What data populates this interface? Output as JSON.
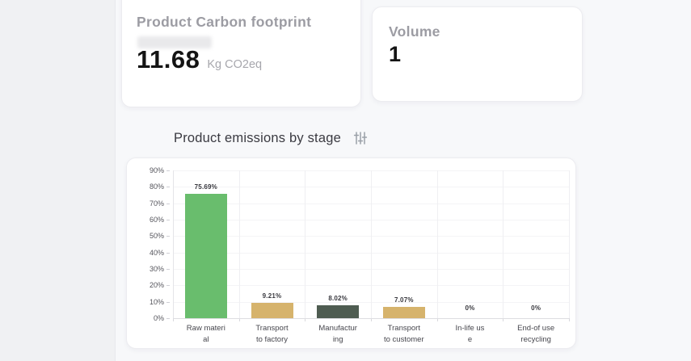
{
  "cards": {
    "pcf": {
      "title": "Product Carbon footprint",
      "value": "11.68",
      "unit": "Kg CO2eq"
    },
    "volume": {
      "title": "Volume",
      "value": "1"
    }
  },
  "section": {
    "title": "Product emissions by stage",
    "filter_icon": "sliders-icon"
  },
  "colors": {
    "green_bar": "#69bd6d",
    "tan_bar": "#d6b36c",
    "dark_green_bar": "#4e5c51",
    "card_title_gray": "#9c9ca3",
    "value_black": "#141414"
  },
  "chart_data": {
    "type": "bar",
    "title": "Product emissions by stage",
    "categories": [
      [
        "Raw materi",
        "al"
      ],
      [
        "Transport",
        "to factory"
      ],
      [
        "Manufactur",
        "ing"
      ],
      [
        "Transport",
        "to customer"
      ],
      [
        "In-life us",
        "e"
      ],
      [
        "End-of use",
        "recycling"
      ]
    ],
    "values": [
      75.69,
      9.21,
      8.02,
      7.07,
      0,
      0
    ],
    "value_labels": [
      "75.69%",
      "9.21%",
      "8.02%",
      "7.07%",
      "0%",
      "0%"
    ],
    "bar_colors": [
      "#69bd6d",
      "#d6b36c",
      "#4e5c51",
      "#d6b36c",
      "#d6b36c",
      "#d6b36c"
    ],
    "yticks": [
      "0%",
      "10%",
      "20%",
      "30%",
      "40%",
      "50%",
      "60%",
      "70%",
      "80%",
      "90%"
    ],
    "ytick_values": [
      0,
      10,
      20,
      30,
      40,
      50,
      60,
      70,
      80,
      90
    ],
    "ylim": [
      0,
      90
    ],
    "xlabel": "",
    "ylabel": "",
    "grid": true,
    "legend": false
  }
}
